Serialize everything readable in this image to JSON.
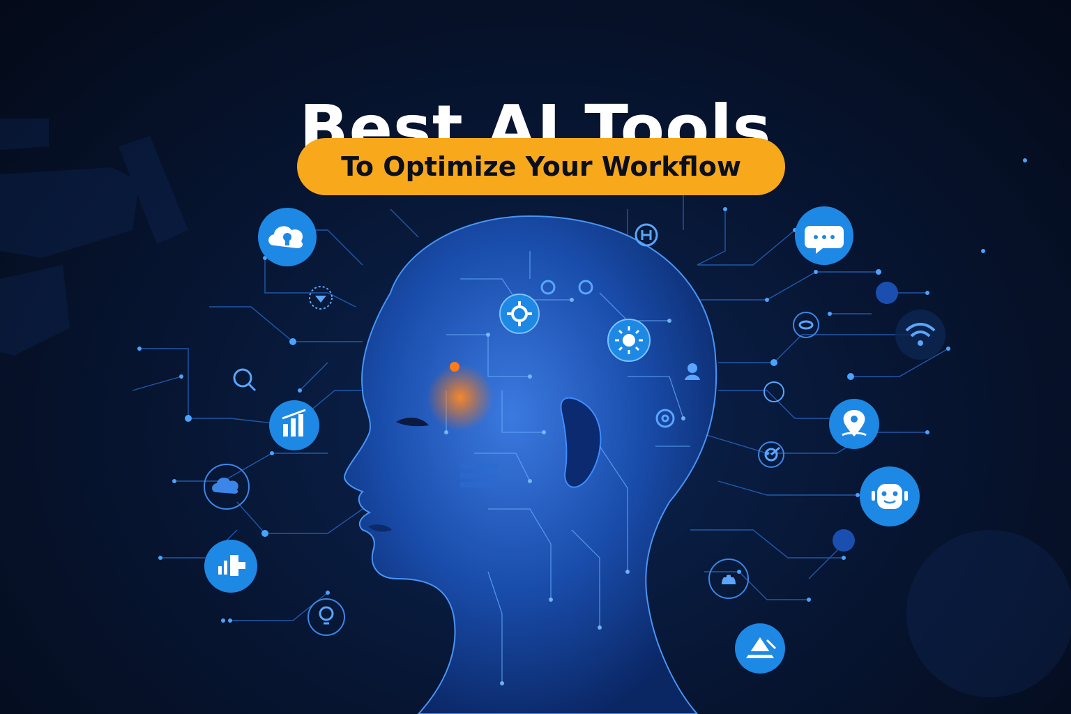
{
  "title": "Best AI Tools",
  "subtitle": "To Optimize Your Workflow",
  "colors": {
    "background": "#050d1e",
    "accent": "#f8a81b",
    "icon_blue": "#1e88e5",
    "circuit": "#2f7fe0",
    "glow_orange": "#ff7a1a"
  },
  "icons": [
    "cloud-lock-icon",
    "chat-bubble-icon",
    "gear-icon",
    "settings-sun-icon",
    "bar-chart-icon",
    "cloud-icon",
    "analytics-icon",
    "location-pin-icon",
    "robot-face-icon",
    "wifi-icon",
    "mountain-icon",
    "search-icon",
    "shield-icon",
    "lightbulb-icon",
    "hospital-icon",
    "user-avatar-icon"
  ]
}
